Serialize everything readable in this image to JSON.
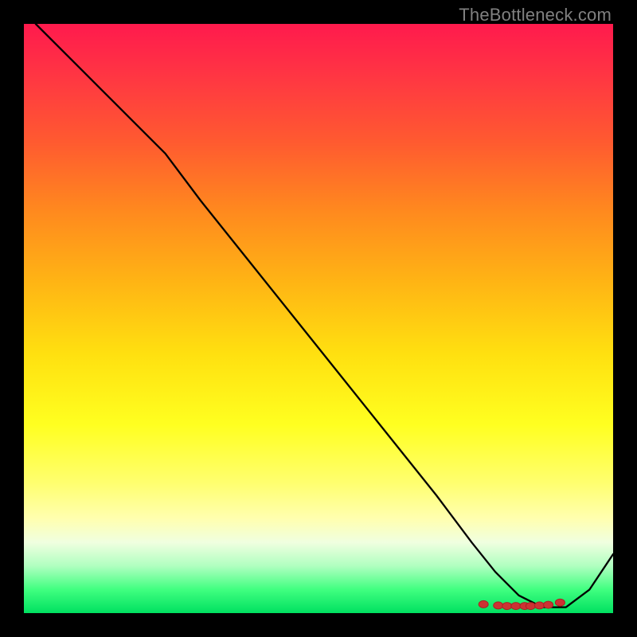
{
  "watermark": "TheBottleneck.com",
  "chart_data": {
    "type": "line",
    "title": "",
    "xlabel": "",
    "ylabel": "",
    "xlim": [
      0,
      100
    ],
    "ylim": [
      0,
      100
    ],
    "note": "No axis ticks or numeric labels are visible; x and y values below are estimated pixel-relative percentages of the plot area (0=left/bottom, 100=right/top).",
    "series": [
      {
        "name": "curve",
        "x": [
          2,
          10,
          18,
          24,
          30,
          38,
          46,
          54,
          62,
          70,
          76,
          80,
          84,
          88,
          92,
          96,
          100
        ],
        "y": [
          100,
          92,
          84,
          78,
          70,
          60,
          50,
          40,
          30,
          20,
          12,
          7,
          3,
          1,
          1,
          4,
          10
        ]
      }
    ],
    "markers": {
      "name": "highlight-cluster",
      "x": [
        78,
        80.5,
        82,
        83.5,
        85,
        86,
        87.5,
        89,
        91
      ],
      "y": [
        1.5,
        1.3,
        1.2,
        1.2,
        1.2,
        1.2,
        1.3,
        1.4,
        1.8
      ]
    }
  }
}
